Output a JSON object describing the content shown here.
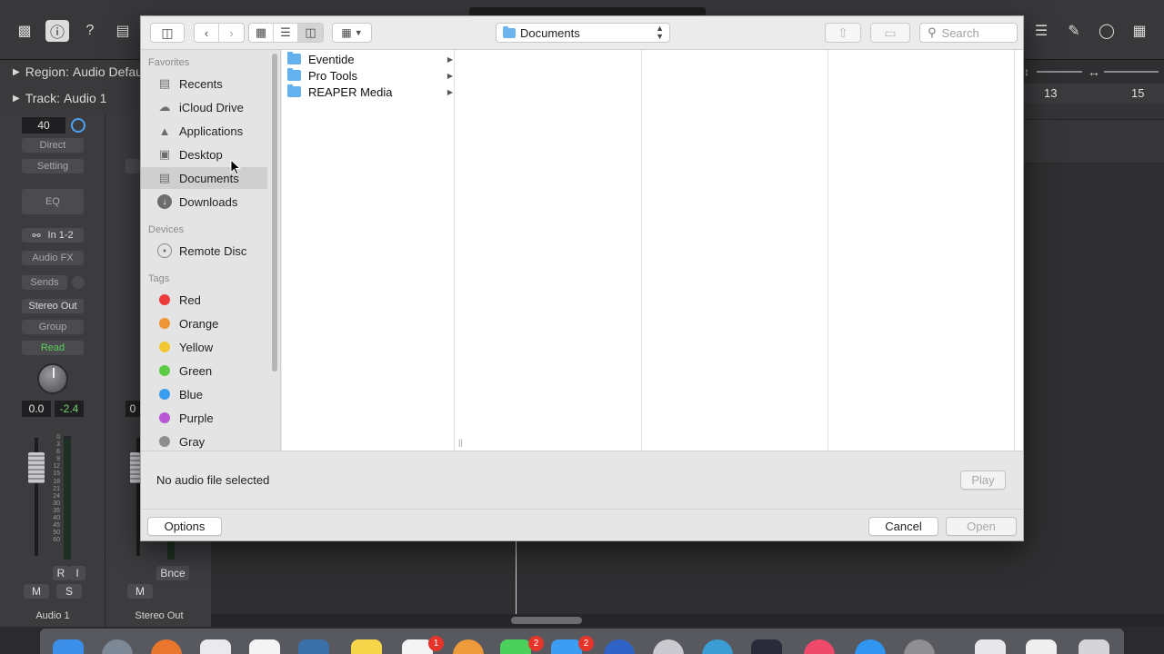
{
  "logic": {
    "region_label": "Region:",
    "region_name": "Audio Defau",
    "track_label": "Track:",
    "track_name": "Audio 1",
    "ruler": [
      "13",
      "15"
    ],
    "strip1": {
      "value_lcd": "40",
      "direct": "Direct",
      "setting": "Setting",
      "eq": "EQ",
      "input": "In 1-2",
      "audio_fx": "Audio FX",
      "sends": "Sends",
      "output": "Stereo Out",
      "group": "Group",
      "automation": "Read",
      "pan_value": "0.0",
      "peak_value": "-2.4",
      "rec_btn": "R",
      "input_btn": "I",
      "mute": "M",
      "solo": "S",
      "name": "Audio 1"
    },
    "strip2": {
      "pan_value": "0",
      "bounce": "Bnce",
      "mute": "M",
      "name": "Stereo Out"
    },
    "meter_scale": [
      "0",
      "3",
      "6",
      "9",
      "12",
      "15",
      "18",
      "21",
      "24",
      "30",
      "35",
      "40",
      "45",
      "50",
      "60"
    ],
    "dock_badges": [
      "1",
      "2",
      "2"
    ]
  },
  "dialog": {
    "location": "Documents",
    "search_placeholder": "Search",
    "sidebar": {
      "favorites_header": "Favorites",
      "favorites": [
        {
          "label": "Recents",
          "icon": "recents-icon"
        },
        {
          "label": "iCloud Drive",
          "icon": "cloud-icon"
        },
        {
          "label": "Applications",
          "icon": "applications-icon"
        },
        {
          "label": "Desktop",
          "icon": "desktop-icon"
        },
        {
          "label": "Documents",
          "icon": "documents-icon",
          "selected": true
        },
        {
          "label": "Downloads",
          "icon": "downloads-icon"
        }
      ],
      "devices_header": "Devices",
      "devices": [
        {
          "label": "Remote Disc",
          "icon": "disc-icon"
        }
      ],
      "tags_header": "Tags",
      "tags": [
        {
          "label": "Red",
          "color": "#ec3b3b"
        },
        {
          "label": "Orange",
          "color": "#f09536"
        },
        {
          "label": "Yellow",
          "color": "#f1c832"
        },
        {
          "label": "Green",
          "color": "#5ccb43"
        },
        {
          "label": "Blue",
          "color": "#3a9ef0"
        },
        {
          "label": "Purple",
          "color": "#b957d6"
        },
        {
          "label": "Gray",
          "color": "#8d8d8d"
        }
      ]
    },
    "files": [
      "Eventide",
      "Pro Tools",
      "REAPER Media"
    ],
    "preview_status": "No audio file selected",
    "play_label": "Play",
    "options_label": "Options",
    "cancel_label": "Cancel",
    "open_label": "Open"
  }
}
